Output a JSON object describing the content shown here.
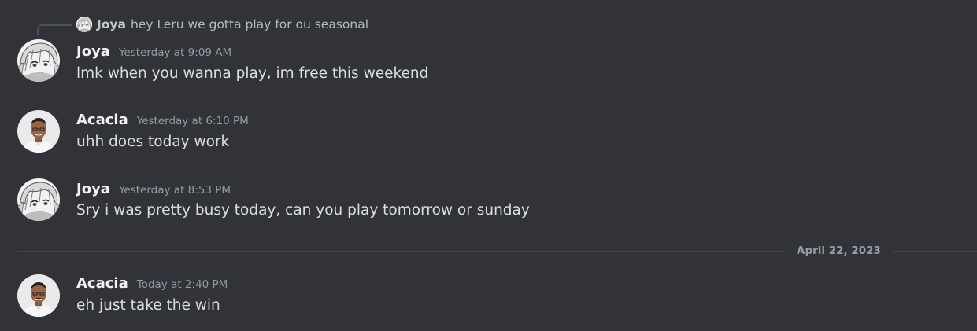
{
  "reply": {
    "username": "Joya",
    "text": "hey Leru we gotta play for ou seasonal"
  },
  "messages": [
    {
      "username": "Joya",
      "timestamp": "Yesterday at 9:09 AM",
      "text": "lmk when you wanna play, im free this weekend",
      "avatar": "manga-avatar"
    },
    {
      "username": "Acacia",
      "timestamp": "Yesterday at 6:10 PM",
      "text": "uhh does today work",
      "avatar": "photo-avatar"
    },
    {
      "username": "Joya",
      "timestamp": "Yesterday at 8:53 PM",
      "text": "Sry i was pretty busy today, can you play tomorrow or sunday",
      "avatar": "manga-avatar"
    },
    {
      "username": "Acacia",
      "timestamp": "Today at 2:40 PM",
      "text": "eh just take the win",
      "avatar": "photo-avatar"
    }
  ],
  "divider": {
    "date": "April 22, 2023"
  },
  "colors": {
    "background": "#313338",
    "username": "#f2f3f5",
    "timestamp": "#949ba4",
    "message_text": "#dbdee1",
    "divider": "#3f4147"
  }
}
